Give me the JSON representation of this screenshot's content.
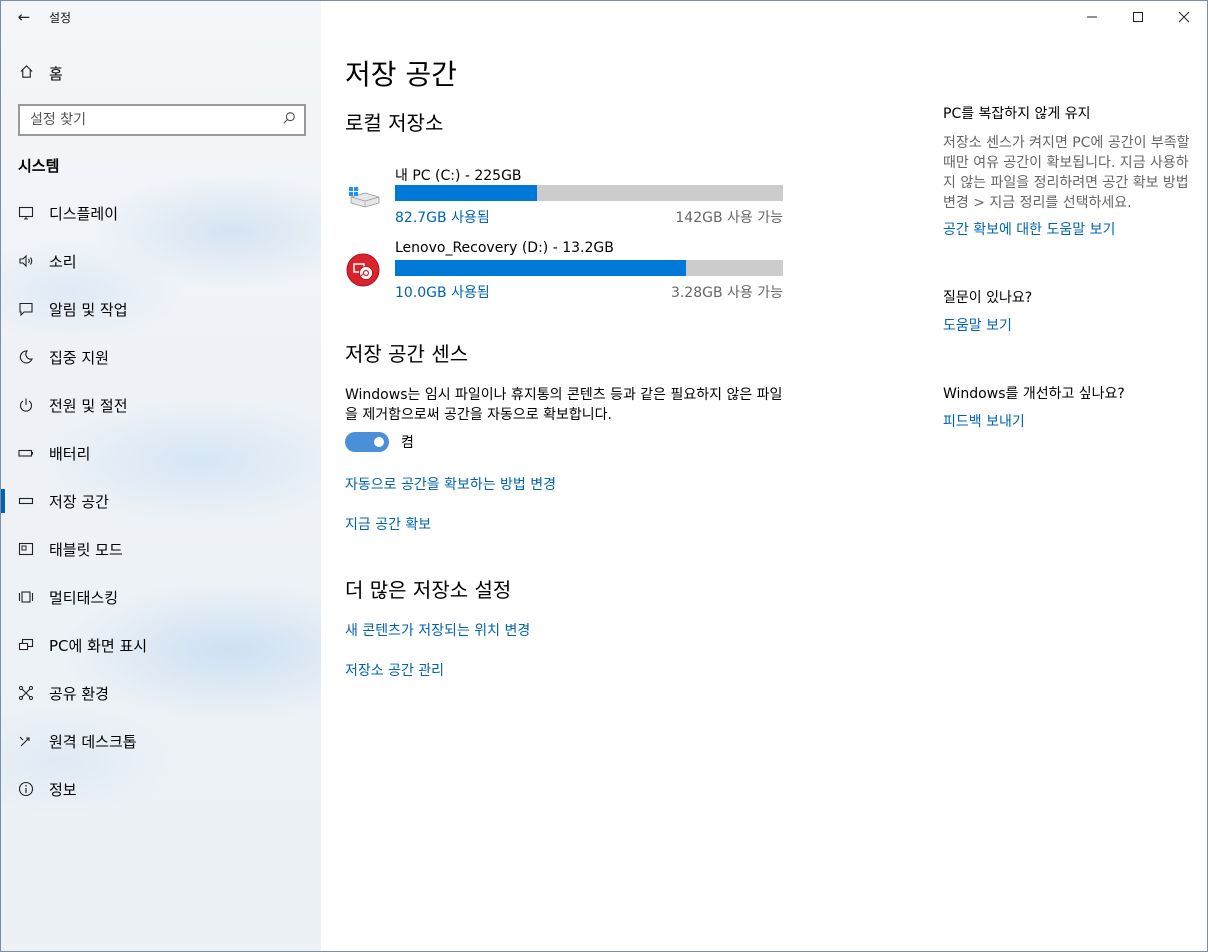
{
  "app": {
    "title": "설정"
  },
  "sidebar": {
    "home": "홈",
    "search_placeholder": "설정 찾기",
    "section": "시스템",
    "items": [
      {
        "label": "디스플레이",
        "icon": "monitor-icon"
      },
      {
        "label": "소리",
        "icon": "speaker-icon"
      },
      {
        "label": "알림 및 작업",
        "icon": "notification-icon"
      },
      {
        "label": "집중 지원",
        "icon": "moon-icon"
      },
      {
        "label": "전원 및 절전",
        "icon": "power-icon"
      },
      {
        "label": "배터리",
        "icon": "battery-icon"
      },
      {
        "label": "저장 공간",
        "icon": "storage-icon"
      },
      {
        "label": "태블릿 모드",
        "icon": "tablet-icon"
      },
      {
        "label": "멀티태스킹",
        "icon": "multitask-icon"
      },
      {
        "label": "PC에 화면 표시",
        "icon": "project-icon"
      },
      {
        "label": "공유 환경",
        "icon": "share-icon"
      },
      {
        "label": "원격 데스크톱",
        "icon": "remote-icon"
      },
      {
        "label": "정보",
        "icon": "info-icon"
      }
    ],
    "active_index": 6
  },
  "main": {
    "title": "저장 공간",
    "local_heading": "로컬 저장소",
    "drives": [
      {
        "name": "내 PC (C:) - 225GB",
        "used": "82.7GB 사용됨",
        "free": "142GB 사용 가능",
        "used_fraction": 0.367
      },
      {
        "name": "Lenovo_Recovery (D:) - 13.2GB",
        "used": "10.0GB 사용됨",
        "free": "3.28GB 사용 가능",
        "used_fraction": 0.75
      }
    ],
    "sense_heading": "저장 공간 센스",
    "sense_desc": "Windows는 임시 파일이나 휴지통의 콘텐츠 등과 같은 필요하지 않은 파일을 제거함으로써 공간을 자동으로 확보합니다.",
    "toggle_label": "켬",
    "link_change_auto": "자동으로 공간을 확보하는 방법 변경",
    "link_free_now": "지금 공간 확보",
    "more_heading": "더 많은 저장소 설정",
    "link_new_content": "새 콘텐츠가 저장되는 위치 변경",
    "link_manage": "저장소 공간 관리"
  },
  "right": {
    "keep_heading": "PC를 복잡하지 않게 유지",
    "keep_text": "저장소 센스가 켜지면 PC에 공간이 부족할 때만 여유 공간이 확보됩니다. 지금 사용하지 않는 파일을 정리하려면 공간 확보 방법 변경 > 지금 정리를 선택하세요.",
    "keep_link": "공간 확보에 대한 도움말 보기",
    "question_heading": "질문이 있나요?",
    "question_link": "도움말 보기",
    "improve_heading": "Windows를 개선하고 싶나요?",
    "improve_link": "피드백 보내기"
  },
  "colors": {
    "accent": "#0078d7",
    "link": "#0063b1",
    "bar_bg": "#cccccc"
  }
}
